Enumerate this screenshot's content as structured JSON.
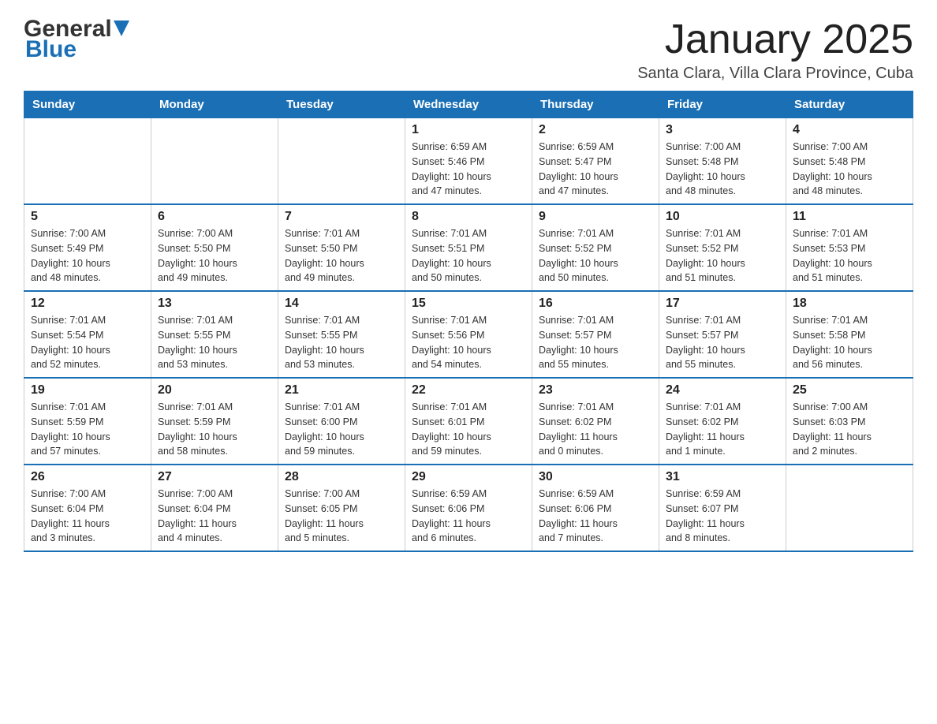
{
  "header": {
    "logo_general": "General",
    "logo_blue": "Blue",
    "month_title": "January 2025",
    "location": "Santa Clara, Villa Clara Province, Cuba"
  },
  "weekdays": [
    "Sunday",
    "Monday",
    "Tuesday",
    "Wednesday",
    "Thursday",
    "Friday",
    "Saturday"
  ],
  "weeks": [
    [
      {
        "day": "",
        "info": ""
      },
      {
        "day": "",
        "info": ""
      },
      {
        "day": "",
        "info": ""
      },
      {
        "day": "1",
        "info": "Sunrise: 6:59 AM\nSunset: 5:46 PM\nDaylight: 10 hours\nand 47 minutes."
      },
      {
        "day": "2",
        "info": "Sunrise: 6:59 AM\nSunset: 5:47 PM\nDaylight: 10 hours\nand 47 minutes."
      },
      {
        "day": "3",
        "info": "Sunrise: 7:00 AM\nSunset: 5:48 PM\nDaylight: 10 hours\nand 48 minutes."
      },
      {
        "day": "4",
        "info": "Sunrise: 7:00 AM\nSunset: 5:48 PM\nDaylight: 10 hours\nand 48 minutes."
      }
    ],
    [
      {
        "day": "5",
        "info": "Sunrise: 7:00 AM\nSunset: 5:49 PM\nDaylight: 10 hours\nand 48 minutes."
      },
      {
        "day": "6",
        "info": "Sunrise: 7:00 AM\nSunset: 5:50 PM\nDaylight: 10 hours\nand 49 minutes."
      },
      {
        "day": "7",
        "info": "Sunrise: 7:01 AM\nSunset: 5:50 PM\nDaylight: 10 hours\nand 49 minutes."
      },
      {
        "day": "8",
        "info": "Sunrise: 7:01 AM\nSunset: 5:51 PM\nDaylight: 10 hours\nand 50 minutes."
      },
      {
        "day": "9",
        "info": "Sunrise: 7:01 AM\nSunset: 5:52 PM\nDaylight: 10 hours\nand 50 minutes."
      },
      {
        "day": "10",
        "info": "Sunrise: 7:01 AM\nSunset: 5:52 PM\nDaylight: 10 hours\nand 51 minutes."
      },
      {
        "day": "11",
        "info": "Sunrise: 7:01 AM\nSunset: 5:53 PM\nDaylight: 10 hours\nand 51 minutes."
      }
    ],
    [
      {
        "day": "12",
        "info": "Sunrise: 7:01 AM\nSunset: 5:54 PM\nDaylight: 10 hours\nand 52 minutes."
      },
      {
        "day": "13",
        "info": "Sunrise: 7:01 AM\nSunset: 5:55 PM\nDaylight: 10 hours\nand 53 minutes."
      },
      {
        "day": "14",
        "info": "Sunrise: 7:01 AM\nSunset: 5:55 PM\nDaylight: 10 hours\nand 53 minutes."
      },
      {
        "day": "15",
        "info": "Sunrise: 7:01 AM\nSunset: 5:56 PM\nDaylight: 10 hours\nand 54 minutes."
      },
      {
        "day": "16",
        "info": "Sunrise: 7:01 AM\nSunset: 5:57 PM\nDaylight: 10 hours\nand 55 minutes."
      },
      {
        "day": "17",
        "info": "Sunrise: 7:01 AM\nSunset: 5:57 PM\nDaylight: 10 hours\nand 55 minutes."
      },
      {
        "day": "18",
        "info": "Sunrise: 7:01 AM\nSunset: 5:58 PM\nDaylight: 10 hours\nand 56 minutes."
      }
    ],
    [
      {
        "day": "19",
        "info": "Sunrise: 7:01 AM\nSunset: 5:59 PM\nDaylight: 10 hours\nand 57 minutes."
      },
      {
        "day": "20",
        "info": "Sunrise: 7:01 AM\nSunset: 5:59 PM\nDaylight: 10 hours\nand 58 minutes."
      },
      {
        "day": "21",
        "info": "Sunrise: 7:01 AM\nSunset: 6:00 PM\nDaylight: 10 hours\nand 59 minutes."
      },
      {
        "day": "22",
        "info": "Sunrise: 7:01 AM\nSunset: 6:01 PM\nDaylight: 10 hours\nand 59 minutes."
      },
      {
        "day": "23",
        "info": "Sunrise: 7:01 AM\nSunset: 6:02 PM\nDaylight: 11 hours\nand 0 minutes."
      },
      {
        "day": "24",
        "info": "Sunrise: 7:01 AM\nSunset: 6:02 PM\nDaylight: 11 hours\nand 1 minute."
      },
      {
        "day": "25",
        "info": "Sunrise: 7:00 AM\nSunset: 6:03 PM\nDaylight: 11 hours\nand 2 minutes."
      }
    ],
    [
      {
        "day": "26",
        "info": "Sunrise: 7:00 AM\nSunset: 6:04 PM\nDaylight: 11 hours\nand 3 minutes."
      },
      {
        "day": "27",
        "info": "Sunrise: 7:00 AM\nSunset: 6:04 PM\nDaylight: 11 hours\nand 4 minutes."
      },
      {
        "day": "28",
        "info": "Sunrise: 7:00 AM\nSunset: 6:05 PM\nDaylight: 11 hours\nand 5 minutes."
      },
      {
        "day": "29",
        "info": "Sunrise: 6:59 AM\nSunset: 6:06 PM\nDaylight: 11 hours\nand 6 minutes."
      },
      {
        "day": "30",
        "info": "Sunrise: 6:59 AM\nSunset: 6:06 PM\nDaylight: 11 hours\nand 7 minutes."
      },
      {
        "day": "31",
        "info": "Sunrise: 6:59 AM\nSunset: 6:07 PM\nDaylight: 11 hours\nand 8 minutes."
      },
      {
        "day": "",
        "info": ""
      }
    ]
  ]
}
